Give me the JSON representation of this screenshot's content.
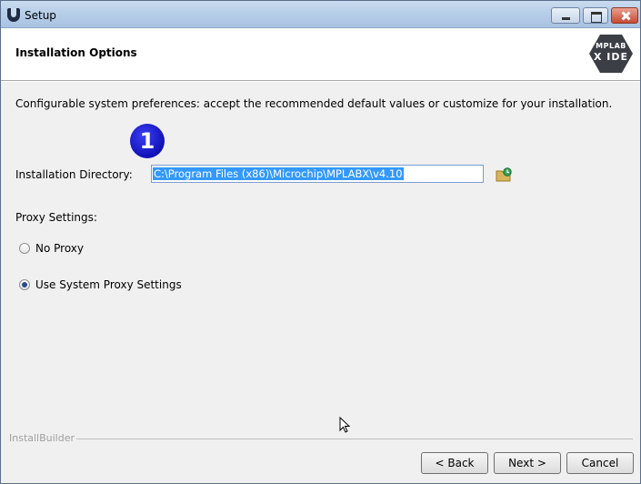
{
  "window": {
    "title": "Setup"
  },
  "header": {
    "title": "Installation Options",
    "logo_line1": "MPLAB",
    "logo_line2": "X IDE"
  },
  "main": {
    "intro": "Configurable system preferences: accept the recommended default values or customize for your installation.",
    "step_number": "1",
    "directory_label": "Installation Directory:",
    "directory_value": "C:\\Program Files (x86)\\Microchip\\MPLABX\\v4.10",
    "proxy_label": "Proxy Settings:",
    "proxy_options": [
      {
        "label": "No Proxy",
        "selected": false
      },
      {
        "label": "Use System Proxy Settings",
        "selected": true
      }
    ]
  },
  "footer": {
    "brand": "InstallBuilder",
    "back_label": "< Back",
    "next_label": "Next >",
    "cancel_label": "Cancel"
  },
  "icons": {
    "browse": "folder-browse-icon",
    "app": "setup-app-icon"
  },
  "colors": {
    "selection": "#3399ff",
    "badge": "#1a1ad0"
  }
}
